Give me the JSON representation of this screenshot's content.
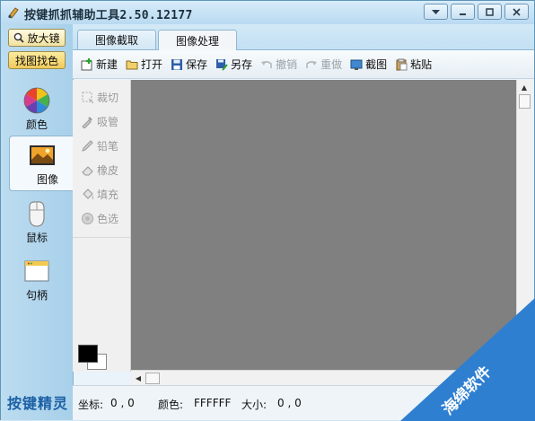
{
  "window": {
    "title": "按键抓抓辅助工具2.50.12177",
    "controls": [
      "dropdown",
      "minimize",
      "maximize",
      "close"
    ]
  },
  "sidebar": {
    "zoom_label": "放大镜",
    "findcolor_label": "找图找色",
    "items": [
      {
        "label": "颜色",
        "icon": "color-wheel-icon"
      },
      {
        "label": "图像",
        "icon": "image-icon",
        "active": true
      },
      {
        "label": "鼠标",
        "icon": "mouse-icon"
      },
      {
        "label": "句柄",
        "icon": "window-handle-icon"
      }
    ],
    "brand": "按键精灵"
  },
  "tabs": [
    {
      "label": "图像截取",
      "active": false
    },
    {
      "label": "图像处理",
      "active": true
    }
  ],
  "toolbar": {
    "new": "新建",
    "open": "打开",
    "save": "保存",
    "save_as": "另存",
    "undo": "撤销",
    "redo": "重做",
    "screenshot": "截图",
    "paste": "粘贴"
  },
  "tools": {
    "crop": "裁切",
    "eyedropper": "吸管",
    "pencil": "铅笔",
    "eraser": "橡皮",
    "fill": "填充",
    "color_select": "色选"
  },
  "colors": {
    "foreground": "#000000",
    "background": "#FFFFFF",
    "canvas": "#808080"
  },
  "status": {
    "coord_label": "坐标:",
    "coord_value": "0 , 0",
    "color_label": "颜色:",
    "color_value": "FFFFFF",
    "size_label": "大小:",
    "size_value": "0 , 0"
  },
  "watermark": {
    "text": "海绵软件"
  }
}
